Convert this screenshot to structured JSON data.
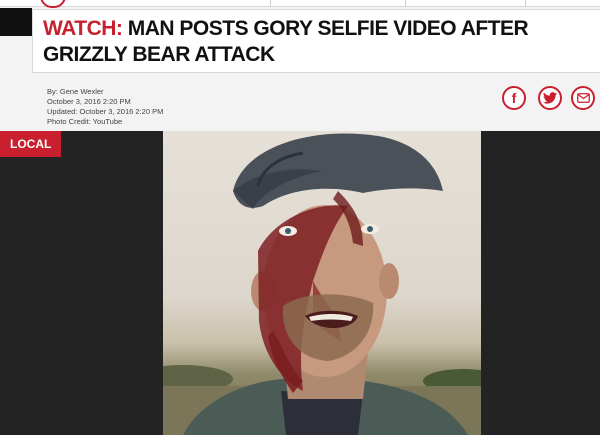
{
  "article": {
    "headline_prefix": "WATCH:",
    "headline_rest": " MAN POSTS GORY SELFIE VIDEO AFTER GRIZZLY BEAR ATTACK",
    "byline": "By: Gene Wexler",
    "posted": "October 3, 2016 2:20 PM",
    "updated": "Updated: October 3, 2016 2:20 PM",
    "photo_credit": "Photo Credit: YouTube"
  },
  "badge": {
    "label": "LOCAL"
  },
  "social": [
    {
      "icon": "facebook-icon",
      "glyph": "f"
    },
    {
      "icon": "twitter-icon",
      "glyph": "🐦"
    },
    {
      "icon": "email-icon",
      "glyph": "✉"
    }
  ],
  "colors": {
    "accent": "#c8202f",
    "video_background": "#232323",
    "page_background": "#f3f3f3"
  }
}
